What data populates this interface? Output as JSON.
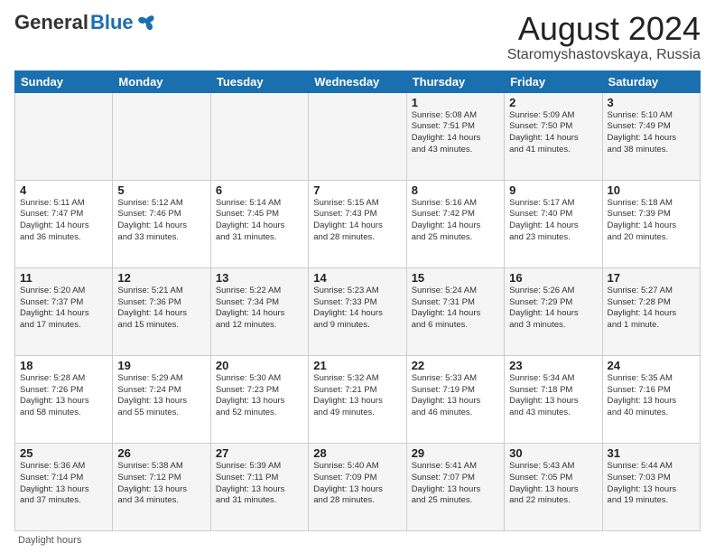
{
  "header": {
    "logo_general": "General",
    "logo_blue": "Blue",
    "month_title": "August 2024",
    "location": "Staromyshastovskaya, Russia"
  },
  "footer": {
    "note": "Daylight hours"
  },
  "days_of_week": [
    "Sunday",
    "Monday",
    "Tuesday",
    "Wednesday",
    "Thursday",
    "Friday",
    "Saturday"
  ],
  "weeks": [
    [
      {
        "day": "",
        "info": ""
      },
      {
        "day": "",
        "info": ""
      },
      {
        "day": "",
        "info": ""
      },
      {
        "day": "",
        "info": ""
      },
      {
        "day": "1",
        "info": "Sunrise: 5:08 AM\nSunset: 7:51 PM\nDaylight: 14 hours\nand 43 minutes."
      },
      {
        "day": "2",
        "info": "Sunrise: 5:09 AM\nSunset: 7:50 PM\nDaylight: 14 hours\nand 41 minutes."
      },
      {
        "day": "3",
        "info": "Sunrise: 5:10 AM\nSunset: 7:49 PM\nDaylight: 14 hours\nand 38 minutes."
      }
    ],
    [
      {
        "day": "4",
        "info": "Sunrise: 5:11 AM\nSunset: 7:47 PM\nDaylight: 14 hours\nand 36 minutes."
      },
      {
        "day": "5",
        "info": "Sunrise: 5:12 AM\nSunset: 7:46 PM\nDaylight: 14 hours\nand 33 minutes."
      },
      {
        "day": "6",
        "info": "Sunrise: 5:14 AM\nSunset: 7:45 PM\nDaylight: 14 hours\nand 31 minutes."
      },
      {
        "day": "7",
        "info": "Sunrise: 5:15 AM\nSunset: 7:43 PM\nDaylight: 14 hours\nand 28 minutes."
      },
      {
        "day": "8",
        "info": "Sunrise: 5:16 AM\nSunset: 7:42 PM\nDaylight: 14 hours\nand 25 minutes."
      },
      {
        "day": "9",
        "info": "Sunrise: 5:17 AM\nSunset: 7:40 PM\nDaylight: 14 hours\nand 23 minutes."
      },
      {
        "day": "10",
        "info": "Sunrise: 5:18 AM\nSunset: 7:39 PM\nDaylight: 14 hours\nand 20 minutes."
      }
    ],
    [
      {
        "day": "11",
        "info": "Sunrise: 5:20 AM\nSunset: 7:37 PM\nDaylight: 14 hours\nand 17 minutes."
      },
      {
        "day": "12",
        "info": "Sunrise: 5:21 AM\nSunset: 7:36 PM\nDaylight: 14 hours\nand 15 minutes."
      },
      {
        "day": "13",
        "info": "Sunrise: 5:22 AM\nSunset: 7:34 PM\nDaylight: 14 hours\nand 12 minutes."
      },
      {
        "day": "14",
        "info": "Sunrise: 5:23 AM\nSunset: 7:33 PM\nDaylight: 14 hours\nand 9 minutes."
      },
      {
        "day": "15",
        "info": "Sunrise: 5:24 AM\nSunset: 7:31 PM\nDaylight: 14 hours\nand 6 minutes."
      },
      {
        "day": "16",
        "info": "Sunrise: 5:26 AM\nSunset: 7:29 PM\nDaylight: 14 hours\nand 3 minutes."
      },
      {
        "day": "17",
        "info": "Sunrise: 5:27 AM\nSunset: 7:28 PM\nDaylight: 14 hours\nand 1 minute."
      }
    ],
    [
      {
        "day": "18",
        "info": "Sunrise: 5:28 AM\nSunset: 7:26 PM\nDaylight: 13 hours\nand 58 minutes."
      },
      {
        "day": "19",
        "info": "Sunrise: 5:29 AM\nSunset: 7:24 PM\nDaylight: 13 hours\nand 55 minutes."
      },
      {
        "day": "20",
        "info": "Sunrise: 5:30 AM\nSunset: 7:23 PM\nDaylight: 13 hours\nand 52 minutes."
      },
      {
        "day": "21",
        "info": "Sunrise: 5:32 AM\nSunset: 7:21 PM\nDaylight: 13 hours\nand 49 minutes."
      },
      {
        "day": "22",
        "info": "Sunrise: 5:33 AM\nSunset: 7:19 PM\nDaylight: 13 hours\nand 46 minutes."
      },
      {
        "day": "23",
        "info": "Sunrise: 5:34 AM\nSunset: 7:18 PM\nDaylight: 13 hours\nand 43 minutes."
      },
      {
        "day": "24",
        "info": "Sunrise: 5:35 AM\nSunset: 7:16 PM\nDaylight: 13 hours\nand 40 minutes."
      }
    ],
    [
      {
        "day": "25",
        "info": "Sunrise: 5:36 AM\nSunset: 7:14 PM\nDaylight: 13 hours\nand 37 minutes."
      },
      {
        "day": "26",
        "info": "Sunrise: 5:38 AM\nSunset: 7:12 PM\nDaylight: 13 hours\nand 34 minutes."
      },
      {
        "day": "27",
        "info": "Sunrise: 5:39 AM\nSunset: 7:11 PM\nDaylight: 13 hours\nand 31 minutes."
      },
      {
        "day": "28",
        "info": "Sunrise: 5:40 AM\nSunset: 7:09 PM\nDaylight: 13 hours\nand 28 minutes."
      },
      {
        "day": "29",
        "info": "Sunrise: 5:41 AM\nSunset: 7:07 PM\nDaylight: 13 hours\nand 25 minutes."
      },
      {
        "day": "30",
        "info": "Sunrise: 5:43 AM\nSunset: 7:05 PM\nDaylight: 13 hours\nand 22 minutes."
      },
      {
        "day": "31",
        "info": "Sunrise: 5:44 AM\nSunset: 7:03 PM\nDaylight: 13 hours\nand 19 minutes."
      }
    ]
  ]
}
